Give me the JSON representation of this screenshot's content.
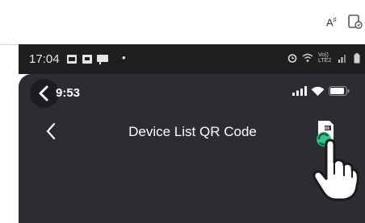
{
  "browser": {
    "read_aloud_icon": "A",
    "read_aloud_sup": "♯",
    "app_icon": "immersive-reader-icon"
  },
  "android_status": {
    "time": "17:04",
    "dot": "•",
    "network_label": "Vo)) LTE2"
  },
  "app": {
    "ios_time": "9:53",
    "title": "Device List QR Code"
  },
  "colors": {
    "background": "#2b2d33",
    "accent": "#27c184"
  }
}
